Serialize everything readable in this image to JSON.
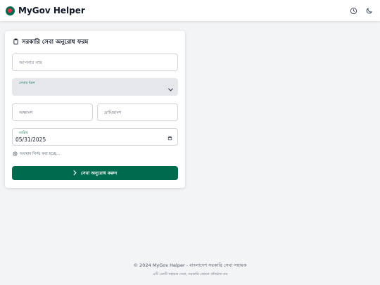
{
  "app": {
    "title": "MyGov Helper",
    "brand_color": "#006a4e",
    "accent_color": "#f42a41"
  },
  "header": {
    "icons": [
      "history-icon",
      "moon-icon"
    ]
  },
  "form": {
    "icon": "clipboard-icon",
    "title": "সরকারি সেবা অনুরোধ ফরম",
    "name_placeholder": "আপনার নাম",
    "service_type": {
      "label": "সেবার ধরন",
      "selected": ""
    },
    "latitude_placeholder": "অক্ষাংশ",
    "longitude_placeholder": "দ্রাঘিমাংশ",
    "date": {
      "label": "তারিখ",
      "value": "05/31/2025"
    },
    "location_status": "অবস্থান নির্ণয় করা হচ্ছে...",
    "submit_label": "সেবা অনুরোধ করুন"
  },
  "footer": {
    "line1": "© 2024 MyGov Helper - বাংলাদেশ সরকারি সেবা সহায়ক",
    "line2": "এটি একটি সহায়ক সেবা, সরকারি কোনো প্রতিষ্ঠান নয়"
  }
}
